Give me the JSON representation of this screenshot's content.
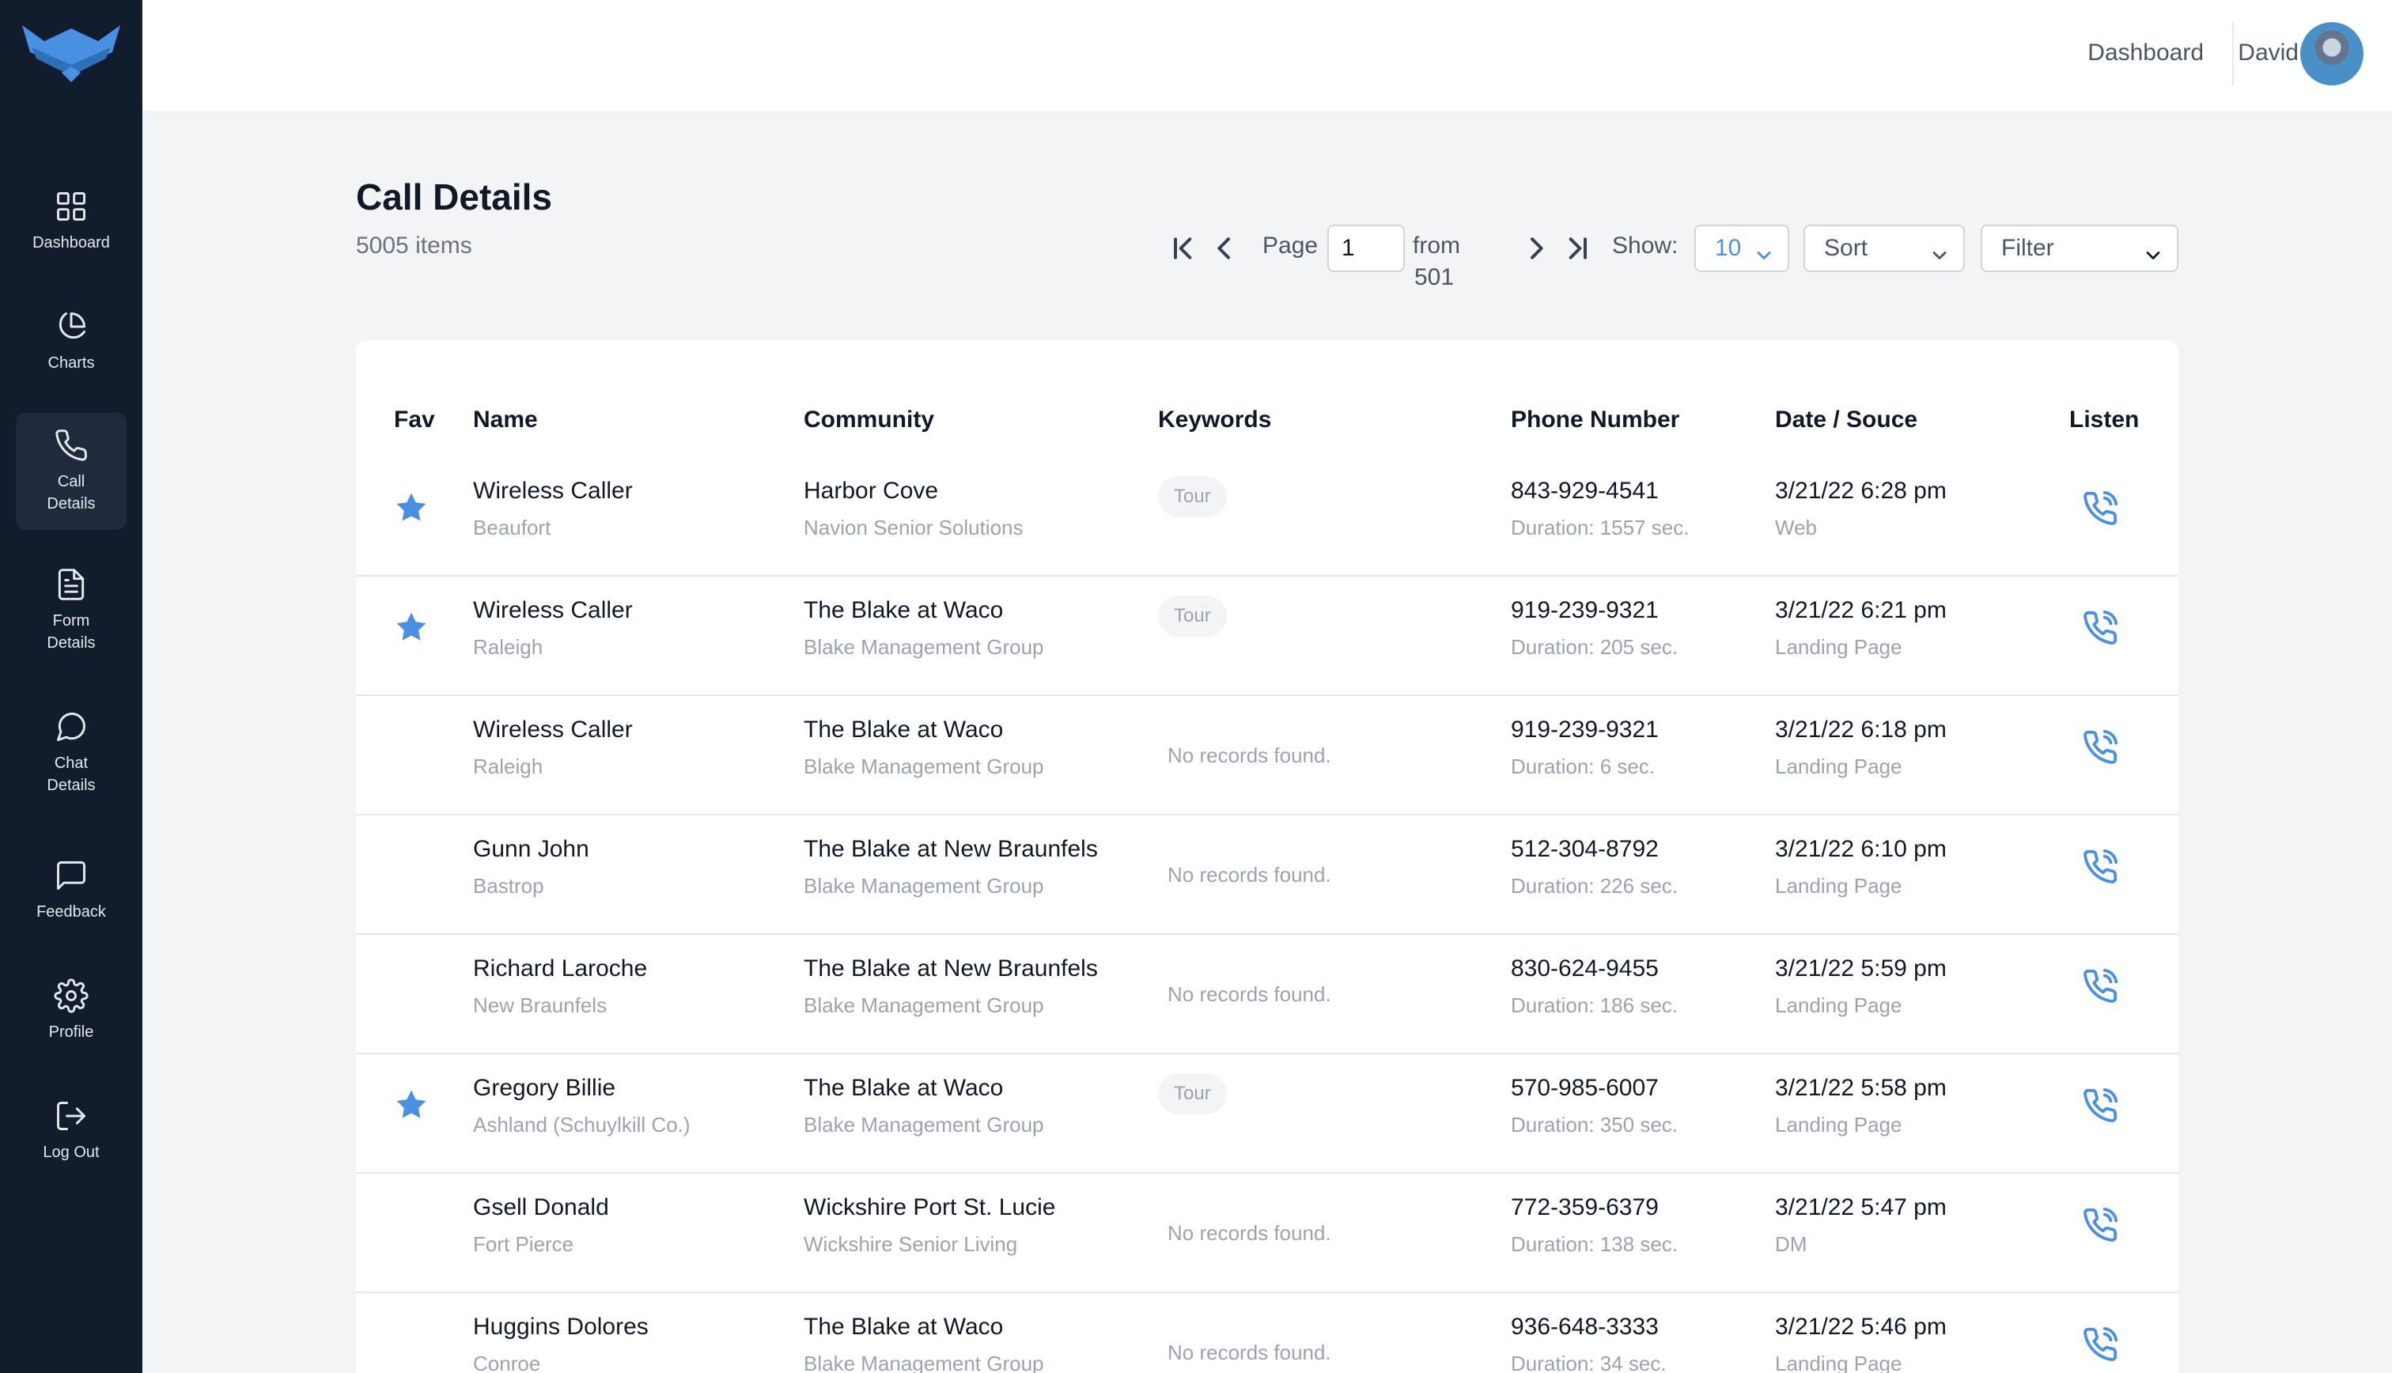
{
  "sidebar": {
    "items": [
      {
        "label": "Dashboard",
        "icon": "grid-icon"
      },
      {
        "label": "Charts",
        "icon": "pie-chart-icon"
      },
      {
        "label": "Call\nDetails",
        "icon": "phone-icon",
        "active": true
      },
      {
        "label": "Form\nDetails",
        "icon": "document-icon"
      },
      {
        "label": "Chat\nDetails",
        "icon": "chat-bubble-icon"
      },
      {
        "label": "Feedback",
        "icon": "message-square-icon"
      },
      {
        "label": "Profile",
        "icon": "gear-icon"
      },
      {
        "label": "Log Out",
        "icon": "logout-icon"
      }
    ]
  },
  "topbar": {
    "dashboard_link": "Dashboard",
    "user_name": "David"
  },
  "page": {
    "title": "Call Details",
    "count": "5005 items"
  },
  "pagination": {
    "page_label": "Page",
    "page_value": "1",
    "from_label": "from",
    "total_pages": "501",
    "show_label": "Show:"
  },
  "controls": {
    "show_value": "10",
    "sort_label": "Sort",
    "filter_label": "Filter"
  },
  "colors": {
    "sidebar_bg": "#111c2c",
    "accent": "#4a90e2"
  },
  "table": {
    "headers": {
      "fav": "Fav",
      "name": "Name",
      "community": "Community",
      "keywords": "Keywords",
      "phone": "Phone Number",
      "date": "Date / Souce",
      "listen": "Listen"
    },
    "rows": [
      {
        "fav": true,
        "name": "Wireless Caller",
        "city": "Beaufort",
        "community": "Harbor Cove",
        "company": "Navion Senior Solutions",
        "keyword": "Tour",
        "phone": "843-929-4541",
        "duration": "Duration: 1557 sec.",
        "date": "3/21/22 6:28 pm",
        "source": "Web"
      },
      {
        "fav": true,
        "name": "Wireless Caller",
        "city": "Raleigh",
        "community": "The Blake at Waco",
        "company": "Blake Management Group",
        "keyword": "Tour",
        "phone": "919-239-9321",
        "duration": "Duration: 205 sec.",
        "date": "3/21/22 6:21 pm",
        "source": "Landing Page"
      },
      {
        "fav": false,
        "name": "Wireless Caller",
        "city": "Raleigh",
        "community": "The Blake at Waco",
        "company": "Blake Management Group",
        "keyword": "",
        "no_records": "No records found.",
        "phone": "919-239-9321",
        "duration": "Duration: 6 sec.",
        "date": "3/21/22 6:18 pm",
        "source": "Landing Page"
      },
      {
        "fav": false,
        "name": "Gunn John",
        "city": "Bastrop",
        "community": "The Blake at New Braunfels",
        "company": "Blake Management Group",
        "keyword": "",
        "no_records": "No records found.",
        "phone": "512-304-8792",
        "duration": "Duration: 226 sec.",
        "date": "3/21/22 6:10 pm",
        "source": "Landing Page"
      },
      {
        "fav": false,
        "name": "Richard Laroche",
        "city": "New Braunfels",
        "community": "The Blake at New Braunfels",
        "company": "Blake Management Group",
        "keyword": "",
        "no_records": "No records found.",
        "phone": "830-624-9455",
        "duration": "Duration: 186 sec.",
        "date": "3/21/22 5:59 pm",
        "source": "Landing Page"
      },
      {
        "fav": true,
        "name": "Gregory Billie",
        "city": "Ashland (Schuylkill Co.)",
        "community": "The Blake at Waco",
        "company": "Blake Management Group",
        "keyword": "Tour",
        "phone": "570-985-6007",
        "duration": "Duration: 350 sec.",
        "date": "3/21/22 5:58 pm",
        "source": "Landing Page"
      },
      {
        "fav": false,
        "name": "Gsell Donald",
        "city": "Fort Pierce",
        "community": "Wickshire Port St. Lucie",
        "company": "Wickshire Senior Living",
        "keyword": "",
        "no_records": "No records found.",
        "phone": "772-359-6379",
        "duration": "Duration: 138 sec.",
        "date": "3/21/22 5:47 pm",
        "source": "DM"
      },
      {
        "fav": false,
        "name": "Huggins Dolores",
        "city": "Conroe",
        "community": "The Blake at Waco",
        "company": "Blake Management Group",
        "keyword": "",
        "no_records": "No records found.",
        "phone": "936-648-3333",
        "duration": "Duration: 34 sec.",
        "date": "3/21/22 5:46 pm",
        "source": "Landing Page"
      }
    ]
  }
}
